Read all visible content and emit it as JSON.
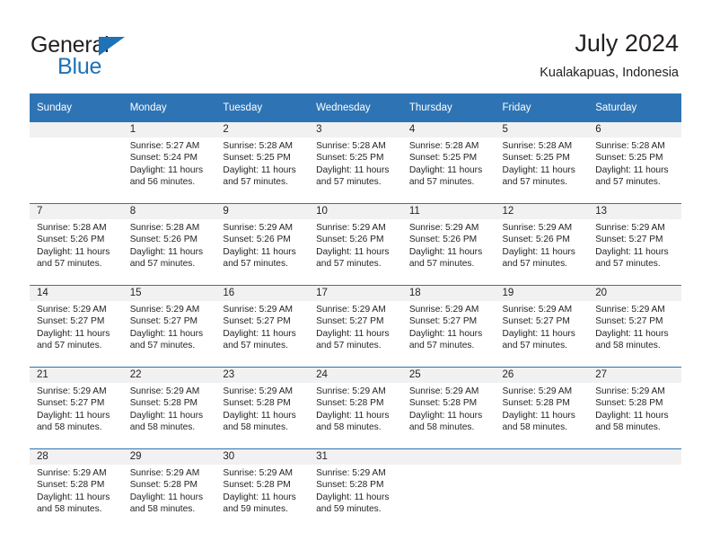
{
  "brand": {
    "name_part1": "General",
    "name_part2": "Blue",
    "triangle_color": "#1e72b8",
    "text_color": "#231f20"
  },
  "header": {
    "title": "July 2024",
    "subtitle": "Kualakapuas, Indonesia"
  },
  "theme": {
    "header_blue": "#2e74b5",
    "daynum_band": "#f1f1f1",
    "text": "#231f20",
    "page_background": "#ffffff"
  },
  "weekday_headers": [
    "Sunday",
    "Monday",
    "Tuesday",
    "Wednesday",
    "Thursday",
    "Friday",
    "Saturday"
  ],
  "weeks": [
    [
      {
        "day": "",
        "sunrise": "",
        "sunset": "",
        "daylight_line1": "",
        "daylight_line2": ""
      },
      {
        "day": "1",
        "sunrise": "Sunrise: 5:27 AM",
        "sunset": "Sunset: 5:24 PM",
        "daylight_line1": "Daylight: 11 hours",
        "daylight_line2": "and 56 minutes."
      },
      {
        "day": "2",
        "sunrise": "Sunrise: 5:28 AM",
        "sunset": "Sunset: 5:25 PM",
        "daylight_line1": "Daylight: 11 hours",
        "daylight_line2": "and 57 minutes."
      },
      {
        "day": "3",
        "sunrise": "Sunrise: 5:28 AM",
        "sunset": "Sunset: 5:25 PM",
        "daylight_line1": "Daylight: 11 hours",
        "daylight_line2": "and 57 minutes."
      },
      {
        "day": "4",
        "sunrise": "Sunrise: 5:28 AM",
        "sunset": "Sunset: 5:25 PM",
        "daylight_line1": "Daylight: 11 hours",
        "daylight_line2": "and 57 minutes."
      },
      {
        "day": "5",
        "sunrise": "Sunrise: 5:28 AM",
        "sunset": "Sunset: 5:25 PM",
        "daylight_line1": "Daylight: 11 hours",
        "daylight_line2": "and 57 minutes."
      },
      {
        "day": "6",
        "sunrise": "Sunrise: 5:28 AM",
        "sunset": "Sunset: 5:25 PM",
        "daylight_line1": "Daylight: 11 hours",
        "daylight_line2": "and 57 minutes."
      }
    ],
    [
      {
        "day": "7",
        "sunrise": "Sunrise: 5:28 AM",
        "sunset": "Sunset: 5:26 PM",
        "daylight_line1": "Daylight: 11 hours",
        "daylight_line2": "and 57 minutes."
      },
      {
        "day": "8",
        "sunrise": "Sunrise: 5:28 AM",
        "sunset": "Sunset: 5:26 PM",
        "daylight_line1": "Daylight: 11 hours",
        "daylight_line2": "and 57 minutes."
      },
      {
        "day": "9",
        "sunrise": "Sunrise: 5:29 AM",
        "sunset": "Sunset: 5:26 PM",
        "daylight_line1": "Daylight: 11 hours",
        "daylight_line2": "and 57 minutes."
      },
      {
        "day": "10",
        "sunrise": "Sunrise: 5:29 AM",
        "sunset": "Sunset: 5:26 PM",
        "daylight_line1": "Daylight: 11 hours",
        "daylight_line2": "and 57 minutes."
      },
      {
        "day": "11",
        "sunrise": "Sunrise: 5:29 AM",
        "sunset": "Sunset: 5:26 PM",
        "daylight_line1": "Daylight: 11 hours",
        "daylight_line2": "and 57 minutes."
      },
      {
        "day": "12",
        "sunrise": "Sunrise: 5:29 AM",
        "sunset": "Sunset: 5:26 PM",
        "daylight_line1": "Daylight: 11 hours",
        "daylight_line2": "and 57 minutes."
      },
      {
        "day": "13",
        "sunrise": "Sunrise: 5:29 AM",
        "sunset": "Sunset: 5:27 PM",
        "daylight_line1": "Daylight: 11 hours",
        "daylight_line2": "and 57 minutes."
      }
    ],
    [
      {
        "day": "14",
        "sunrise": "Sunrise: 5:29 AM",
        "sunset": "Sunset: 5:27 PM",
        "daylight_line1": "Daylight: 11 hours",
        "daylight_line2": "and 57 minutes."
      },
      {
        "day": "15",
        "sunrise": "Sunrise: 5:29 AM",
        "sunset": "Sunset: 5:27 PM",
        "daylight_line1": "Daylight: 11 hours",
        "daylight_line2": "and 57 minutes."
      },
      {
        "day": "16",
        "sunrise": "Sunrise: 5:29 AM",
        "sunset": "Sunset: 5:27 PM",
        "daylight_line1": "Daylight: 11 hours",
        "daylight_line2": "and 57 minutes."
      },
      {
        "day": "17",
        "sunrise": "Sunrise: 5:29 AM",
        "sunset": "Sunset: 5:27 PM",
        "daylight_line1": "Daylight: 11 hours",
        "daylight_line2": "and 57 minutes."
      },
      {
        "day": "18",
        "sunrise": "Sunrise: 5:29 AM",
        "sunset": "Sunset: 5:27 PM",
        "daylight_line1": "Daylight: 11 hours",
        "daylight_line2": "and 57 minutes."
      },
      {
        "day": "19",
        "sunrise": "Sunrise: 5:29 AM",
        "sunset": "Sunset: 5:27 PM",
        "daylight_line1": "Daylight: 11 hours",
        "daylight_line2": "and 57 minutes."
      },
      {
        "day": "20",
        "sunrise": "Sunrise: 5:29 AM",
        "sunset": "Sunset: 5:27 PM",
        "daylight_line1": "Daylight: 11 hours",
        "daylight_line2": "and 58 minutes."
      }
    ],
    [
      {
        "day": "21",
        "sunrise": "Sunrise: 5:29 AM",
        "sunset": "Sunset: 5:27 PM",
        "daylight_line1": "Daylight: 11 hours",
        "daylight_line2": "and 58 minutes."
      },
      {
        "day": "22",
        "sunrise": "Sunrise: 5:29 AM",
        "sunset": "Sunset: 5:28 PM",
        "daylight_line1": "Daylight: 11 hours",
        "daylight_line2": "and 58 minutes."
      },
      {
        "day": "23",
        "sunrise": "Sunrise: 5:29 AM",
        "sunset": "Sunset: 5:28 PM",
        "daylight_line1": "Daylight: 11 hours",
        "daylight_line2": "and 58 minutes."
      },
      {
        "day": "24",
        "sunrise": "Sunrise: 5:29 AM",
        "sunset": "Sunset: 5:28 PM",
        "daylight_line1": "Daylight: 11 hours",
        "daylight_line2": "and 58 minutes."
      },
      {
        "day": "25",
        "sunrise": "Sunrise: 5:29 AM",
        "sunset": "Sunset: 5:28 PM",
        "daylight_line1": "Daylight: 11 hours",
        "daylight_line2": "and 58 minutes."
      },
      {
        "day": "26",
        "sunrise": "Sunrise: 5:29 AM",
        "sunset": "Sunset: 5:28 PM",
        "daylight_line1": "Daylight: 11 hours",
        "daylight_line2": "and 58 minutes."
      },
      {
        "day": "27",
        "sunrise": "Sunrise: 5:29 AM",
        "sunset": "Sunset: 5:28 PM",
        "daylight_line1": "Daylight: 11 hours",
        "daylight_line2": "and 58 minutes."
      }
    ],
    [
      {
        "day": "28",
        "sunrise": "Sunrise: 5:29 AM",
        "sunset": "Sunset: 5:28 PM",
        "daylight_line1": "Daylight: 11 hours",
        "daylight_line2": "and 58 minutes."
      },
      {
        "day": "29",
        "sunrise": "Sunrise: 5:29 AM",
        "sunset": "Sunset: 5:28 PM",
        "daylight_line1": "Daylight: 11 hours",
        "daylight_line2": "and 58 minutes."
      },
      {
        "day": "30",
        "sunrise": "Sunrise: 5:29 AM",
        "sunset": "Sunset: 5:28 PM",
        "daylight_line1": "Daylight: 11 hours",
        "daylight_line2": "and 59 minutes."
      },
      {
        "day": "31",
        "sunrise": "Sunrise: 5:29 AM",
        "sunset": "Sunset: 5:28 PM",
        "daylight_line1": "Daylight: 11 hours",
        "daylight_line2": "and 59 minutes."
      },
      {
        "day": "",
        "sunrise": "",
        "sunset": "",
        "daylight_line1": "",
        "daylight_line2": ""
      },
      {
        "day": "",
        "sunrise": "",
        "sunset": "",
        "daylight_line1": "",
        "daylight_line2": ""
      },
      {
        "day": "",
        "sunrise": "",
        "sunset": "",
        "daylight_line1": "",
        "daylight_line2": ""
      }
    ]
  ]
}
